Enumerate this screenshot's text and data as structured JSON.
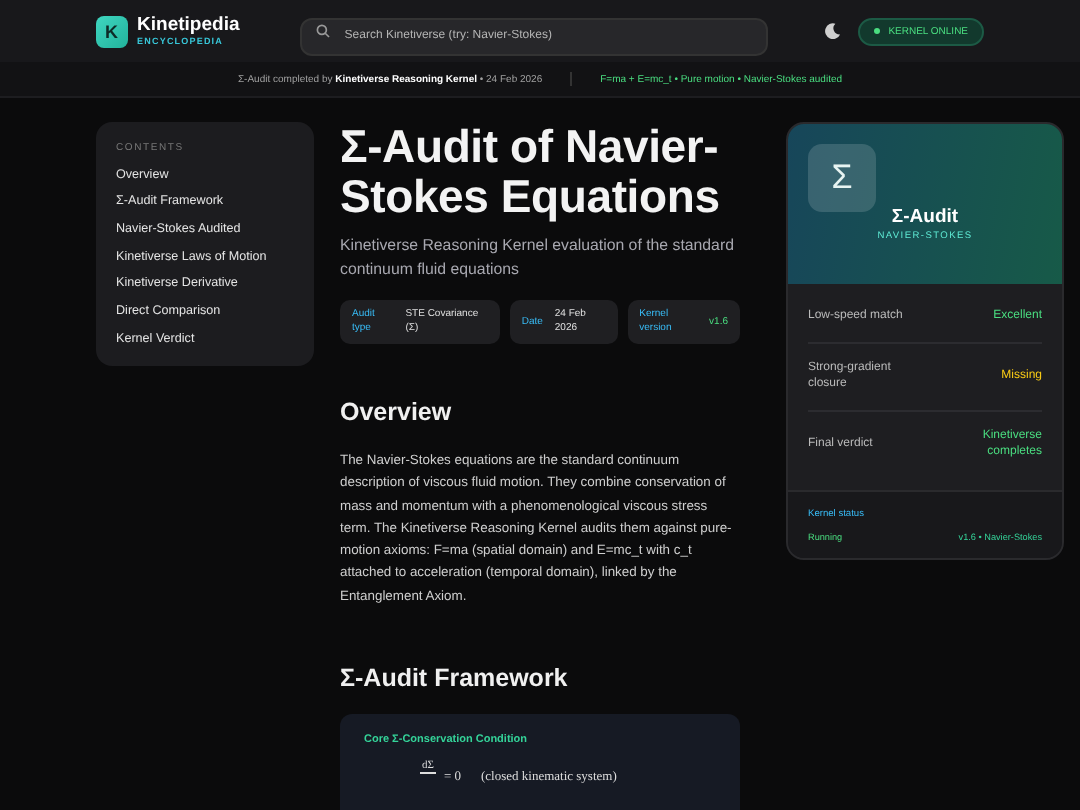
{
  "header": {
    "logo_letter": "K",
    "brand": "Kinetipedia",
    "brand_sub": "ENCYCLOPEDIA",
    "search": {
      "placeholder": "Search Kinetiverse (try: Navier-Stokes)"
    },
    "status_badge": {
      "label": "KERNEL ONLINE",
      "on": true
    }
  },
  "notice_bar": {
    "left": "Σ-Audit completed by **Kinetiverse Reasoning Kernel** • 24 Feb 2026",
    "right": "F=ma + E=mc_t • Pure motion • Navier-Stokes audited"
  },
  "contents": {
    "heading": "CONTENTS",
    "items": [
      {
        "label": "Overview"
      },
      {
        "label": "Σ-Audit Framework"
      },
      {
        "label": "Navier-Stokes Audited"
      },
      {
        "label": "Kinetiverse Laws of Motion"
      },
      {
        "label": "Kinetiverse Derivative"
      },
      {
        "label": "Direct Comparison"
      },
      {
        "label": "Kernel Verdict"
      }
    ]
  },
  "article": {
    "title": "Σ-Audit of Navier-Stokes Equations",
    "subtitle": "Kinetiverse Reasoning Kernel evaluation of the standard continuum fluid equations",
    "meta": [
      {
        "label": "Audit type",
        "value": "STE Covariance (Σ)"
      },
      {
        "label": "Date",
        "value": "24 Feb 2026"
      },
      {
        "label": "Kernel version",
        "value": "v1.6"
      }
    ],
    "sections": [
      {
        "heading": "Overview",
        "text": "The Navier-Stokes equations are the standard continuum description of viscous fluid motion. They combine conservation of mass and momentum with a phenomenological viscous stress term. The Kinetiverse Reasoning Kernel audits them against pure-motion axioms: F=ma (spatial domain) and E=mc_t with c_t attached to acceleration (temporal domain), linked by the Entanglement Axiom."
      },
      {
        "heading": "Σ-Audit Framework",
        "callout": {
          "title": "Core Σ-Conservation Condition",
          "numerator": "dΣ",
          "rhs": "= 0",
          "note": "(closed kinematic system)"
        }
      }
    ]
  },
  "infobox": {
    "symbol": "Σ",
    "title": "Σ-Audit",
    "subtitle": "NAVIER-STOKES",
    "rows": [
      {
        "label": "Low-speed match",
        "value": "Excellent",
        "kind": "good"
      },
      {
        "label": "Strong-gradient closure",
        "value": "Missing",
        "kind": "warn"
      },
      {
        "label": "Final verdict",
        "value": "Kinetiverse completes",
        "kind": "good"
      }
    ],
    "status": {
      "heading": "Kernel status",
      "state": "Running",
      "version": "v1.6 • Navier-Stokes"
    }
  }
}
